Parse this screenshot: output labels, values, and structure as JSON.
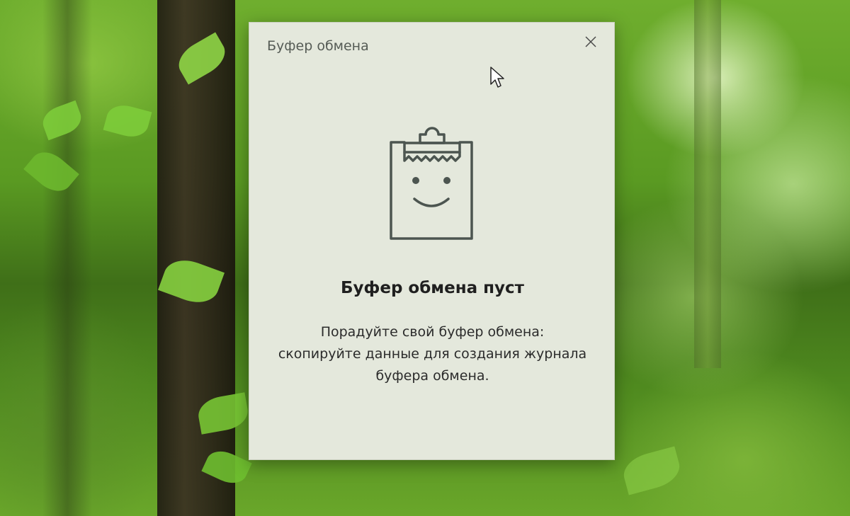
{
  "window": {
    "title": "Буфер обмена"
  },
  "empty_state": {
    "heading": "Буфер обмена пуст",
    "message": "Порадуйте свой буфер обмена:\nскопируйте данные для создания журнала\nбуфера обмена.",
    "icon": "smiling-clipboard-icon"
  },
  "close_icon": "close-icon",
  "colors": {
    "panel_background": "#e4e8dc",
    "icon_stroke": "#4c5550",
    "heading_text": "#1f1f1f",
    "title_text": "#555b55"
  }
}
